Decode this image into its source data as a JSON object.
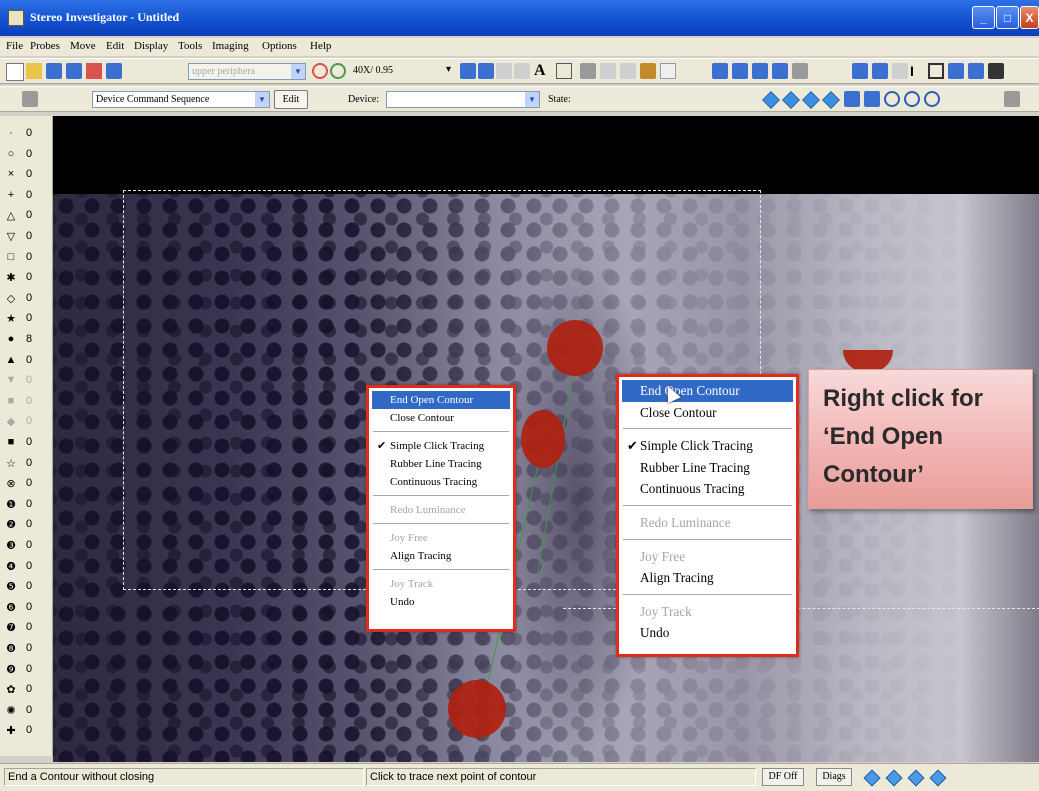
{
  "window": {
    "title": "Stereo Investigator - Untitled",
    "buttons": [
      "_",
      "□",
      "X"
    ]
  },
  "menu": [
    "File",
    "Probes",
    "Move",
    "Edit",
    "Display",
    "Tools",
    "Imaging",
    "Options",
    "Help"
  ],
  "toolbar1": {
    "lens_dropdown": "upper periphera",
    "objective_dropdown": "40X/ 0.95"
  },
  "toolbar2": {
    "sequence_dropdown": "Device Command Sequence",
    "edit_button": "Edit",
    "device_label": "Device:",
    "device_value": "",
    "state_label": "State:"
  },
  "markers": [
    {
      "symbol": "·",
      "count": "0"
    },
    {
      "symbol": "○",
      "count": "0"
    },
    {
      "symbol": "×",
      "count": "0"
    },
    {
      "symbol": "+",
      "count": "0"
    },
    {
      "symbol": "△",
      "count": "0"
    },
    {
      "symbol": "▽",
      "count": "0"
    },
    {
      "symbol": "□",
      "count": "0"
    },
    {
      "symbol": "✱",
      "count": "0"
    },
    {
      "symbol": "◇",
      "count": "0"
    },
    {
      "symbol": "★",
      "count": "0"
    },
    {
      "symbol": "●",
      "count": "8"
    },
    {
      "symbol": "▲",
      "count": "0"
    },
    {
      "symbol": "▼",
      "count": "0"
    },
    {
      "symbol": "■",
      "count": "0"
    },
    {
      "symbol": "◆",
      "count": "0"
    },
    {
      "symbol": "■",
      "count": "0"
    },
    {
      "symbol": "☆",
      "count": "0"
    },
    {
      "symbol": "⊗",
      "count": "0"
    },
    {
      "symbol": "❶",
      "count": "0"
    },
    {
      "symbol": "❷",
      "count": "0"
    },
    {
      "symbol": "❸",
      "count": "0"
    },
    {
      "symbol": "❹",
      "count": "0"
    },
    {
      "symbol": "❺",
      "count": "0"
    },
    {
      "symbol": "❻",
      "count": "0"
    },
    {
      "symbol": "❼",
      "count": "0"
    },
    {
      "symbol": "❽",
      "count": "0"
    },
    {
      "symbol": "❾",
      "count": "0"
    },
    {
      "symbol": "✿",
      "count": "0"
    },
    {
      "symbol": "✺",
      "count": "0"
    },
    {
      "symbol": "✚",
      "count": "0"
    }
  ],
  "context_menu": {
    "items": [
      {
        "label": "End Open Contour",
        "state": "selected"
      },
      {
        "label": "Close Contour",
        "state": "normal"
      },
      {
        "label": "Simple Click Tracing",
        "state": "checked"
      },
      {
        "label": "Rubber Line Tracing",
        "state": "normal"
      },
      {
        "label": "Continuous Tracing",
        "state": "normal"
      },
      {
        "label": "Redo Luminance",
        "state": "disabled"
      },
      {
        "label": "Joy Free",
        "state": "disabled"
      },
      {
        "label": "Align Tracing",
        "state": "normal"
      },
      {
        "label": "Joy Track",
        "state": "disabled"
      },
      {
        "label": "Undo",
        "state": "normal"
      }
    ]
  },
  "callout": {
    "text": "Right click for ‘End Open Contour’"
  },
  "status": {
    "left": "End a Contour without closing",
    "middle": "Click to trace next point of contour",
    "df_button": "DF Off",
    "diags_button": "Diags"
  },
  "colors": {
    "accent_red": "#e02d1b",
    "marker_red": "#b0210f",
    "selection_blue": "#3169c6",
    "titlebar_blue": "#1452d2"
  }
}
